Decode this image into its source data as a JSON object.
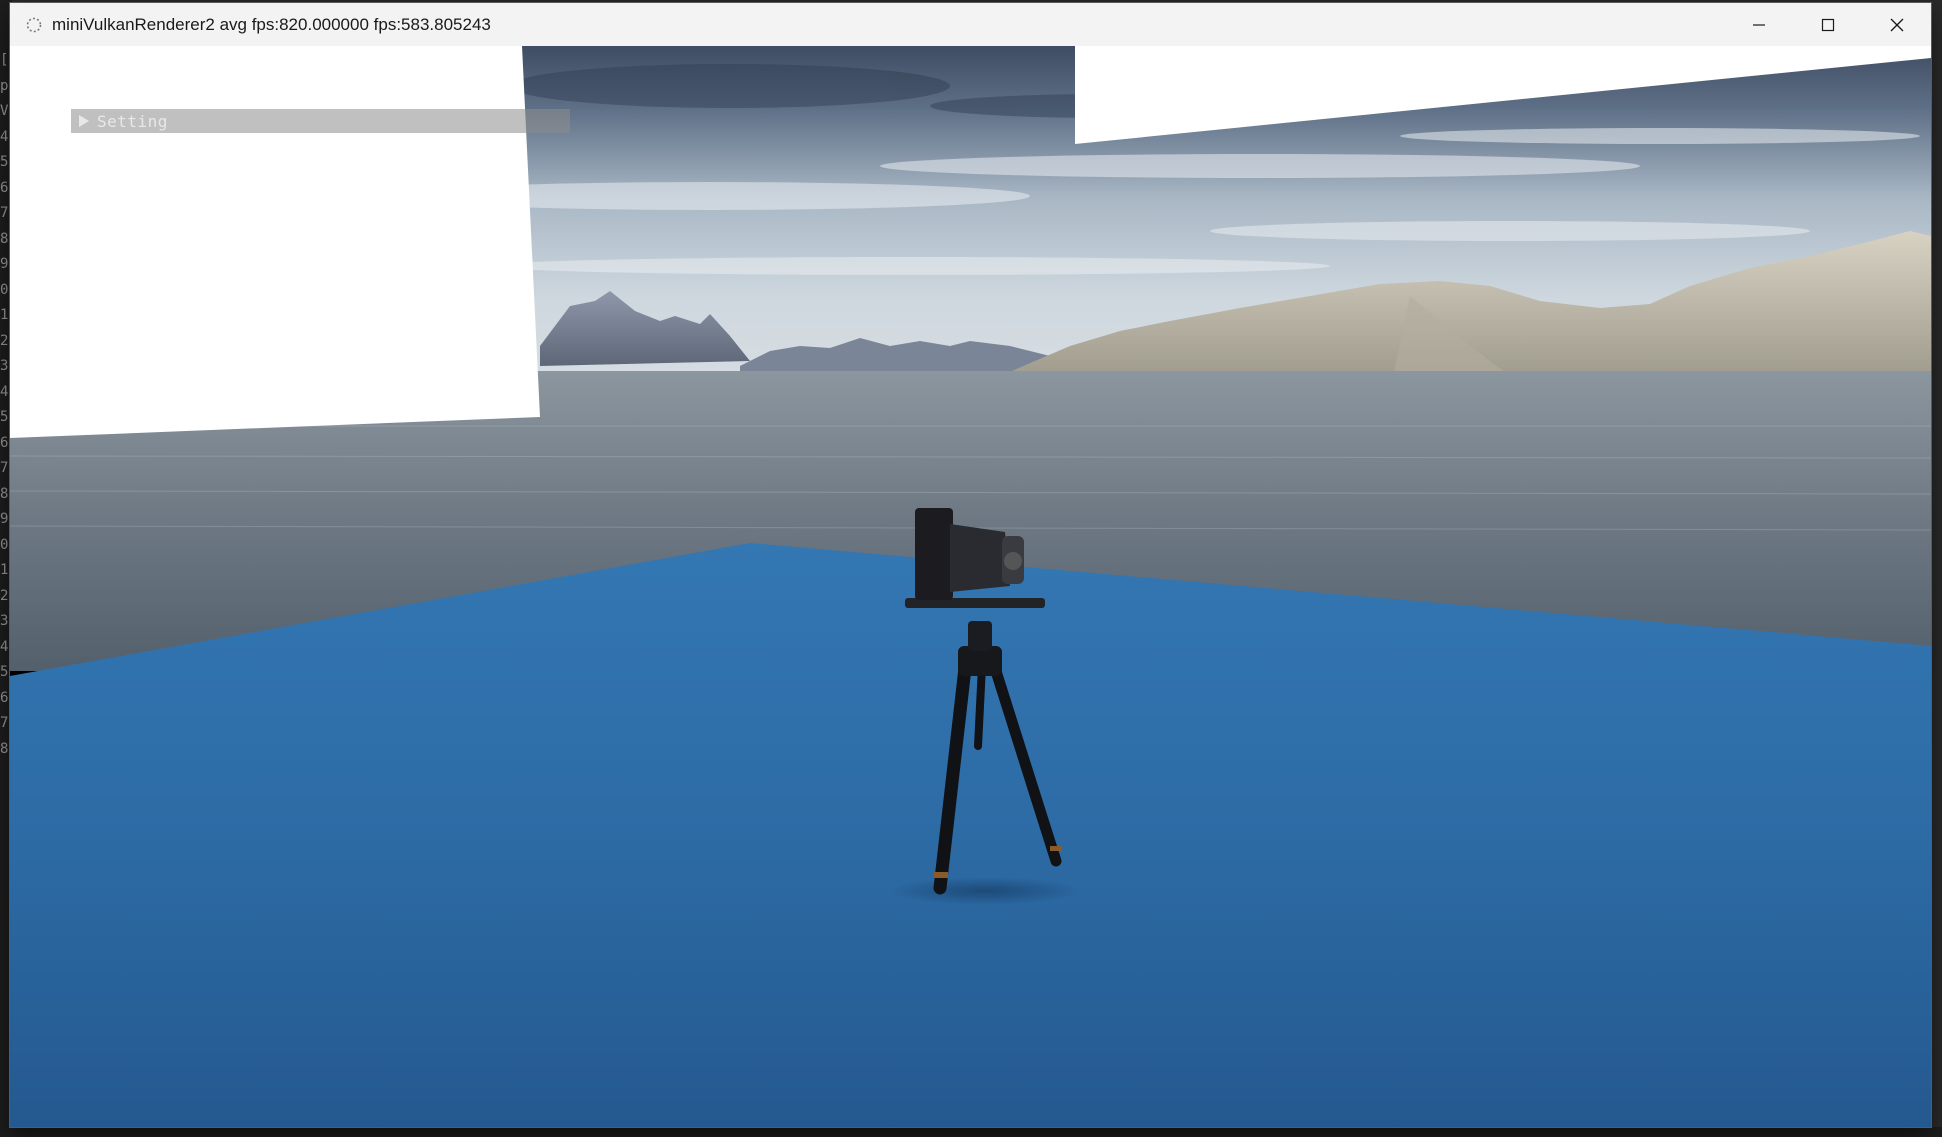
{
  "window": {
    "title": "miniVulkanRenderer2 avg fps:820.000000 fps:583.805243",
    "controls": [
      "minimize",
      "maximize",
      "close"
    ]
  },
  "imgui": {
    "collapsed": true,
    "header_label": "Setting"
  },
  "background_editor": {
    "visible_line_fragments": [
      "[",
      "p",
      "Vu",
      "4",
      "5",
      "6",
      "7",
      "8",
      "9",
      "0",
      "1",
      "2",
      "3",
      "4",
      "5",
      "6",
      "7",
      "8",
      "9",
      "0",
      "1",
      "2",
      "3",
      "4",
      "5",
      "6",
      "7",
      "8"
    ]
  },
  "colors": {
    "titlebar": "#f3f3f3",
    "floor": "#2a69a6",
    "sky_top": "#44546c",
    "sky_bottom": "#c9d3dc",
    "water": "#6e7a85",
    "panel_white": "#ffffff"
  }
}
